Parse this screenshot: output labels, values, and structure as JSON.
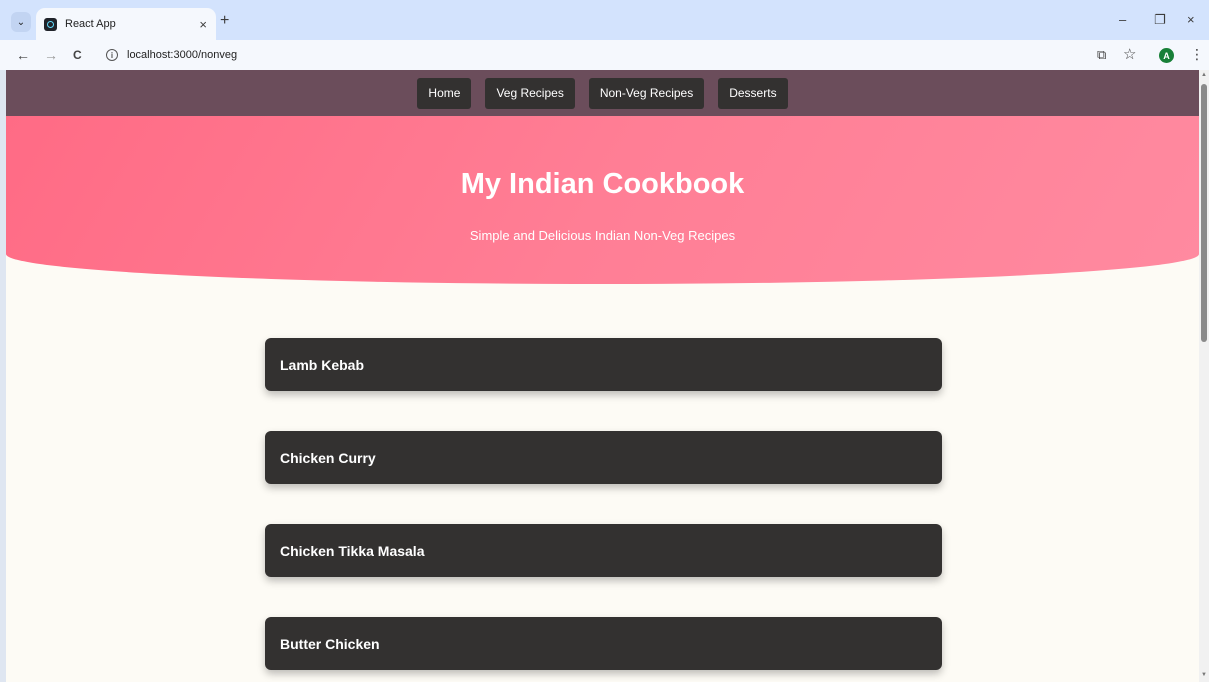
{
  "browser": {
    "tab_title": "React App",
    "tab_close": "×",
    "new_tab": "+",
    "url": "localhost:3000/nonveg",
    "back": "←",
    "forward": "→",
    "reload": "C",
    "info": "i",
    "profile_initial": "A",
    "minimize": "–",
    "restore": "❐",
    "close": "×",
    "cast": "⧉",
    "star": "☆",
    "menu": "⋮",
    "tab_search": "⌄"
  },
  "nav": {
    "items": [
      "Home",
      "Veg Recipes",
      "Non-Veg Recipes",
      "Desserts"
    ]
  },
  "hero": {
    "title": "My Indian Cookbook",
    "subtitle": "Simple and Delicious Indian Non-Veg Recipes"
  },
  "recipes": [
    "Lamb Kebab",
    "Chicken Curry",
    "Chicken Tikka Masala",
    "Butter Chicken"
  ],
  "colors": {
    "navbar": "#6b4d5b",
    "nav_button": "#333130",
    "hero_gradient_start": "#ff6b85",
    "hero_gradient_end": "#ff8aa0",
    "card": "#333130",
    "page_bg": "#fdfbf5"
  },
  "icons": {
    "favicon": "react-icon",
    "info": "info-icon",
    "cast": "cast-icon",
    "star": "bookmark-star-icon",
    "menu": "kebab-menu-icon"
  }
}
